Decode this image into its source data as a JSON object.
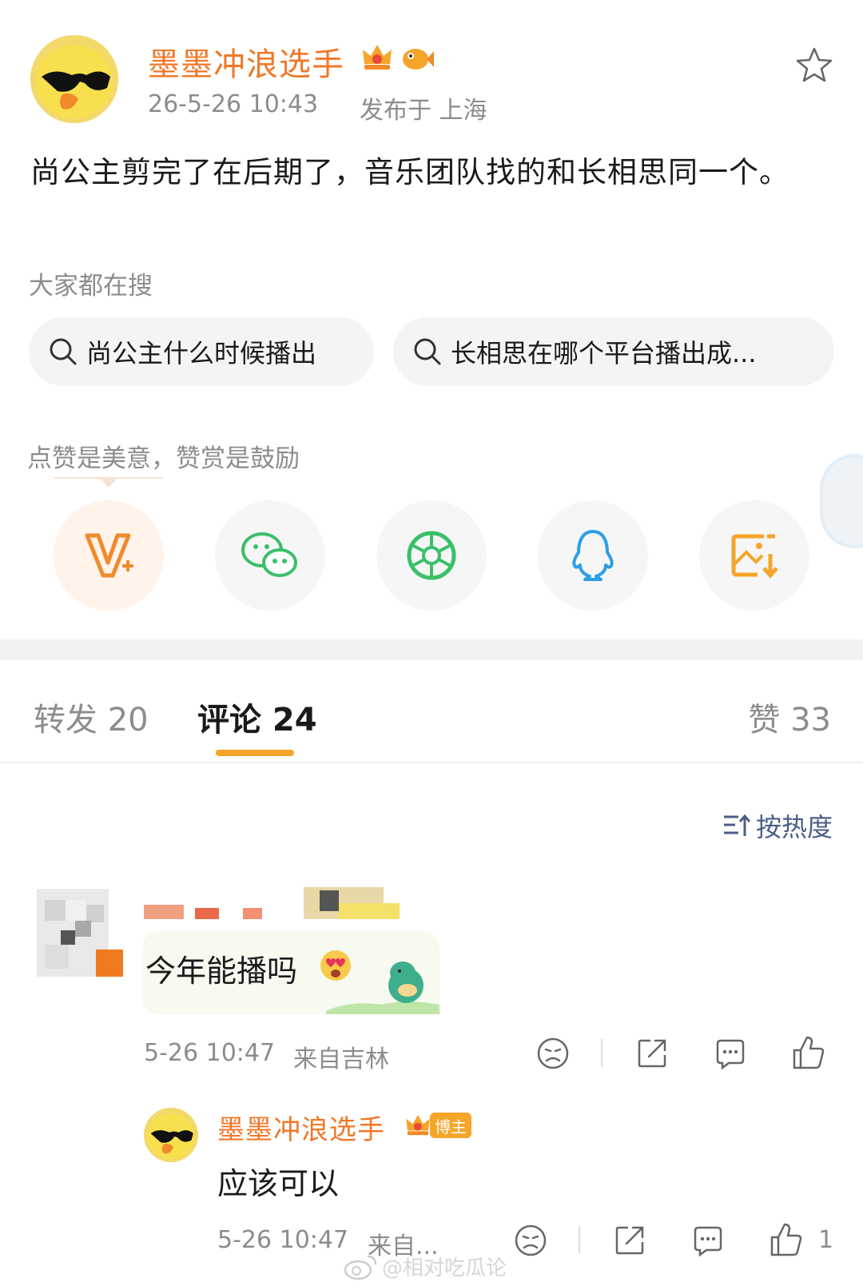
{
  "post": {
    "author": "墨墨冲浪选手",
    "time": "26-5-26 10:43",
    "location": "发布于 上海",
    "text": "尚公主剪完了在后期了，音乐团队找的和长相思同一个。"
  },
  "search": {
    "label": "大家都在搜",
    "items": [
      {
        "text": "尚公主什么时候播出"
      },
      {
        "text": "长相思在哪个平台播出成..."
      }
    ]
  },
  "reward": {
    "label": "点赞是美意，赞赏是鼓励",
    "share_icons": [
      "vplus-icon",
      "wechat-icon",
      "moments-icon",
      "qq-icon",
      "save-image-icon"
    ]
  },
  "tabs": {
    "repost": "转发 20",
    "comment": "评论 24",
    "like": "赞 33"
  },
  "sort": {
    "label": "按热度"
  },
  "comments": [
    {
      "text": "今年能播吗",
      "time": "5-26 10:47",
      "location": "来自吉林",
      "reply": {
        "author": "墨墨冲浪选手",
        "badge": "博主",
        "text": "应该可以",
        "time": "5-26 10:47",
        "location": "来自...",
        "likes": "1"
      }
    }
  ],
  "watermark": "@相对吃瓜论",
  "colors": {
    "author": "#f07828",
    "accent": "#f5a52a",
    "muted": "#8c8c8c",
    "sort_text": "#4b5e86"
  }
}
